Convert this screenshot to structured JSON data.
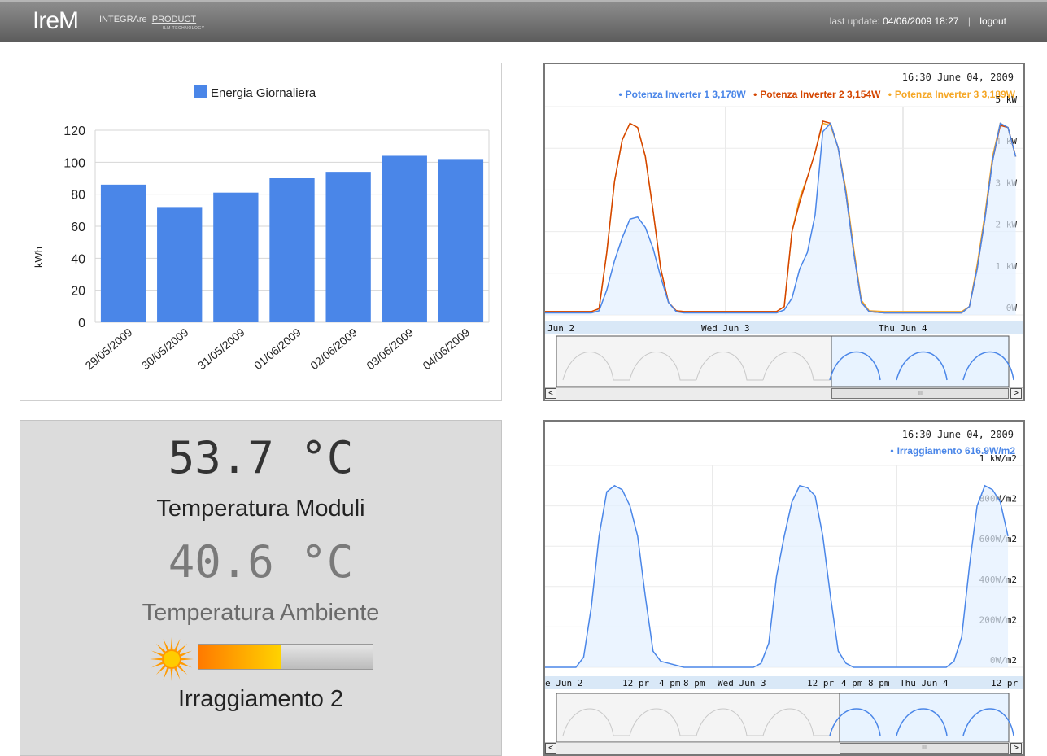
{
  "header": {
    "logo": "IreM",
    "brand_a": "INTEGRAre",
    "brand_b": "PRODUCT",
    "brand_tech": "ILM TECHNOLOGY",
    "last_update_label": "last update:",
    "last_update_value": "04/06/2009 18:27",
    "separator": "|",
    "logout": "logout"
  },
  "colors": {
    "bar": "#4a86e8",
    "inv1": "#4a86e8",
    "inv2": "#d44500",
    "inv3": "#f5a623",
    "irr": "#4a86e8"
  },
  "chart_data": [
    {
      "type": "bar",
      "title": "",
      "legend": [
        "Energia Giornaliera"
      ],
      "ylabel": "kWh",
      "xlabel": "",
      "ylim": [
        0,
        120
      ],
      "yticks": [
        0,
        20,
        40,
        60,
        80,
        100,
        120
      ],
      "categories": [
        "29/05/2009",
        "30/05/2009",
        "31/05/2009",
        "01/06/2009",
        "02/06/2009",
        "03/06/2009",
        "04/06/2009"
      ],
      "series": [
        {
          "name": "Energia Giornaliera",
          "values": [
            86,
            72,
            81,
            90,
            94,
            104,
            102
          ]
        }
      ]
    },
    {
      "type": "line",
      "timestamp": "16:30 June 04, 2009",
      "legend": [
        {
          "name": "Potenza Inverter 1",
          "value": "3,178W"
        },
        {
          "name": "Potenza Inverter 2",
          "value": "3,154W"
        },
        {
          "name": "Potenza Inverter 3",
          "value": "3,189W"
        }
      ],
      "y_tick_labels": [
        "0W",
        "1 kW",
        "2 kW",
        "3 kW",
        "4 kW",
        "5 kW"
      ],
      "x_tick_labels": [
        "Jun 2",
        "Wed Jun 3",
        "Thu Jun 4"
      ],
      "ylim": [
        0,
        5000
      ],
      "x_unit": "hours since start of visible window",
      "series": [
        {
          "name": "Potenza Inverter 1",
          "x": [
            0,
            6,
            7,
            8,
            9,
            10,
            11,
            12,
            13,
            14,
            15,
            16,
            17,
            18,
            20,
            24,
            30,
            31,
            32,
            33,
            34,
            35,
            36,
            37,
            38,
            39,
            40,
            41,
            42,
            44,
            48,
            54,
            55,
            56,
            57,
            58,
            59,
            60,
            61
          ],
          "y": [
            50,
            50,
            100,
            600,
            1300,
            1850,
            2300,
            2350,
            2100,
            1600,
            900,
            300,
            80,
            50,
            50,
            50,
            50,
            120,
            400,
            1100,
            1500,
            2400,
            4400,
            4600,
            4000,
            2900,
            1500,
            300,
            80,
            50,
            50,
            50,
            200,
            1100,
            2300,
            3700,
            4600,
            4500,
            3800
          ]
        },
        {
          "name": "Potenza Inverter 2",
          "x": [
            0,
            6,
            7,
            8,
            9,
            10,
            11,
            12,
            13,
            14,
            15,
            16,
            17,
            18,
            20,
            24,
            30,
            31,
            32,
            33,
            34,
            35,
            36,
            37,
            38,
            39,
            40,
            41,
            42,
            44,
            48,
            54,
            55,
            56,
            57,
            58,
            59,
            60,
            61
          ],
          "y": [
            80,
            80,
            150,
            1500,
            3200,
            4200,
            4600,
            4500,
            3800,
            2500,
            1100,
            300,
            100,
            80,
            80,
            80,
            80,
            200,
            2000,
            2700,
            3300,
            3900,
            4650,
            4600,
            4000,
            2900,
            1500,
            300,
            80,
            50,
            50,
            50,
            200,
            1100,
            2300,
            3700,
            4550,
            4500,
            3800
          ]
        },
        {
          "name": "Potenza Inverter 3",
          "x": [
            0,
            6,
            7,
            8,
            9,
            10,
            11,
            12,
            13,
            14,
            15,
            16,
            17,
            18,
            20,
            24,
            30,
            31,
            32,
            33,
            34,
            35,
            36,
            37,
            38,
            39,
            40,
            41,
            42,
            44,
            48,
            54,
            55,
            56,
            57,
            58,
            59,
            60,
            61
          ],
          "y": [
            80,
            80,
            150,
            1500,
            3200,
            4200,
            4600,
            4500,
            3800,
            2500,
            1100,
            300,
            100,
            80,
            80,
            80,
            80,
            200,
            2000,
            2800,
            3300,
            3900,
            4600,
            4550,
            4000,
            3000,
            1600,
            350,
            100,
            80,
            80,
            80,
            200,
            1200,
            2400,
            3800,
            4600,
            4500,
            3800
          ]
        }
      ]
    },
    {
      "type": "line",
      "timestamp": "16:30 June 04, 2009",
      "legend": [
        {
          "name": "Irraggiamento",
          "value": "616.9W/m2"
        }
      ],
      "y_tick_labels": [
        "0W/m2",
        "200W/m2",
        "400W/m2",
        "600W/m2",
        "800W/m2",
        "1 kW/m2"
      ],
      "x_tick_labels": [
        "e Jun 2",
        "12 pr",
        "4 pm",
        "8 pm",
        "Wed Jun 3",
        "12 pr",
        "4 pm",
        "8 pm",
        "Thu Jun 4",
        "12 pr"
      ],
      "ylim": [
        0,
        1000
      ],
      "x_unit": "hours since start of visible window",
      "series": [
        {
          "name": "Irraggiamento",
          "x": [
            0,
            4,
            5,
            6,
            7,
            8,
            9,
            10,
            11,
            12,
            13,
            14,
            15,
            16,
            18,
            24,
            27,
            28,
            29,
            30,
            31,
            32,
            33,
            34,
            35,
            36,
            37,
            38,
            39,
            40,
            44,
            52,
            53,
            54,
            55,
            56,
            57,
            58,
            59,
            60
          ],
          "y": [
            0,
            0,
            50,
            300,
            650,
            870,
            900,
            880,
            800,
            650,
            350,
            80,
            30,
            20,
            0,
            0,
            0,
            20,
            120,
            450,
            650,
            820,
            900,
            890,
            850,
            650,
            350,
            80,
            20,
            0,
            0,
            0,
            30,
            150,
            500,
            800,
            900,
            880,
            820,
            650
          ]
        }
      ]
    }
  ],
  "temperature": {
    "moduli_value": "53.7 °C",
    "moduli_label": "Temperatura Moduli",
    "ambiente_value": "40.6 °C",
    "ambiente_label": "Temperatura Ambiente",
    "irr_label": "Irraggiamento 2",
    "irr_fraction": 0.47
  },
  "scroll": {
    "left_arrow": "<",
    "right_arrow": ">",
    "thumb_grip": "III"
  }
}
